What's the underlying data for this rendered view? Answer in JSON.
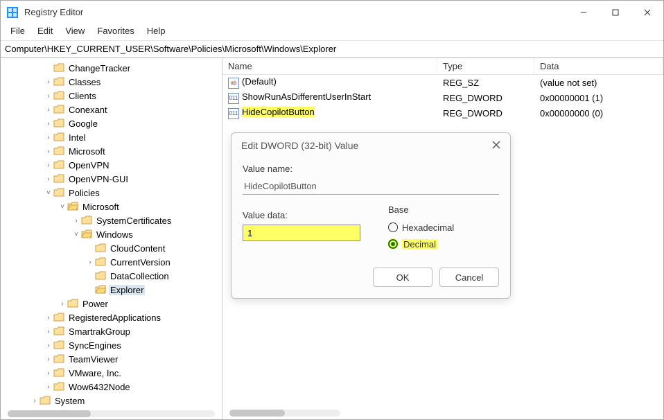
{
  "window": {
    "title": "Registry Editor"
  },
  "menu": {
    "file": "File",
    "edit": "Edit",
    "view": "View",
    "favorites": "Favorites",
    "help": "Help"
  },
  "address": {
    "path": "Computer\\HKEY_CURRENT_USER\\Software\\Policies\\Microsoft\\Windows\\Explorer"
  },
  "tree": {
    "items": [
      {
        "indent": 60,
        "tw": "",
        "label": "ChangeTracker"
      },
      {
        "indent": 60,
        "tw": ">",
        "label": "Classes"
      },
      {
        "indent": 60,
        "tw": ">",
        "label": "Clients"
      },
      {
        "indent": 60,
        "tw": ">",
        "label": "Conexant"
      },
      {
        "indent": 60,
        "tw": ">",
        "label": "Google"
      },
      {
        "indent": 60,
        "tw": ">",
        "label": "Intel"
      },
      {
        "indent": 60,
        "tw": ">",
        "label": "Microsoft"
      },
      {
        "indent": 60,
        "tw": ">",
        "label": "OpenVPN"
      },
      {
        "indent": 60,
        "tw": ">",
        "label": "OpenVPN-GUI"
      },
      {
        "indent": 60,
        "tw": "v",
        "label": "Policies"
      },
      {
        "indent": 80,
        "tw": "v",
        "label": "Microsoft",
        "open": true
      },
      {
        "indent": 100,
        "tw": ">",
        "label": "SystemCertificates"
      },
      {
        "indent": 100,
        "tw": "v",
        "label": "Windows",
        "open": true
      },
      {
        "indent": 120,
        "tw": "",
        "label": "CloudContent"
      },
      {
        "indent": 120,
        "tw": ">",
        "label": "CurrentVersion"
      },
      {
        "indent": 120,
        "tw": "",
        "label": "DataCollection"
      },
      {
        "indent": 120,
        "tw": "",
        "label": "Explorer",
        "selected": true,
        "open": true
      },
      {
        "indent": 80,
        "tw": ">",
        "label": "Power"
      },
      {
        "indent": 60,
        "tw": ">",
        "label": "RegisteredApplications"
      },
      {
        "indent": 60,
        "tw": ">",
        "label": "SmartrakGroup"
      },
      {
        "indent": 60,
        "tw": ">",
        "label": "SyncEngines"
      },
      {
        "indent": 60,
        "tw": ">",
        "label": "TeamViewer"
      },
      {
        "indent": 60,
        "tw": ">",
        "label": "VMware, Inc."
      },
      {
        "indent": 60,
        "tw": ">",
        "label": "Wow6432Node"
      },
      {
        "indent": 40,
        "tw": ">",
        "label": "System"
      }
    ]
  },
  "list": {
    "columns": {
      "name": "Name",
      "type": "Type",
      "data": "Data"
    },
    "rows": [
      {
        "icon": "str",
        "name": "(Default)",
        "type": "REG_SZ",
        "data": "(value not set)",
        "highlight": false
      },
      {
        "icon": "bin",
        "name": "ShowRunAsDifferentUserInStart",
        "type": "REG_DWORD",
        "data": "0x00000001 (1)",
        "highlight": false
      },
      {
        "icon": "bin",
        "name": "HideCopilotButton",
        "type": "REG_DWORD",
        "data": "0x00000000 (0)",
        "highlight": true
      }
    ]
  },
  "dialog": {
    "title": "Edit DWORD (32-bit) Value",
    "value_name_label": "Value name:",
    "value_name": "HideCopilotButton",
    "value_data_label": "Value data:",
    "value_data": "1",
    "base_label": "Base",
    "radio_hex": "Hexadecimal",
    "radio_dec": "Decimal",
    "ok": "OK",
    "cancel": "Cancel"
  },
  "icons": {
    "str_glyph": "ab",
    "bin_glyph": "011"
  }
}
